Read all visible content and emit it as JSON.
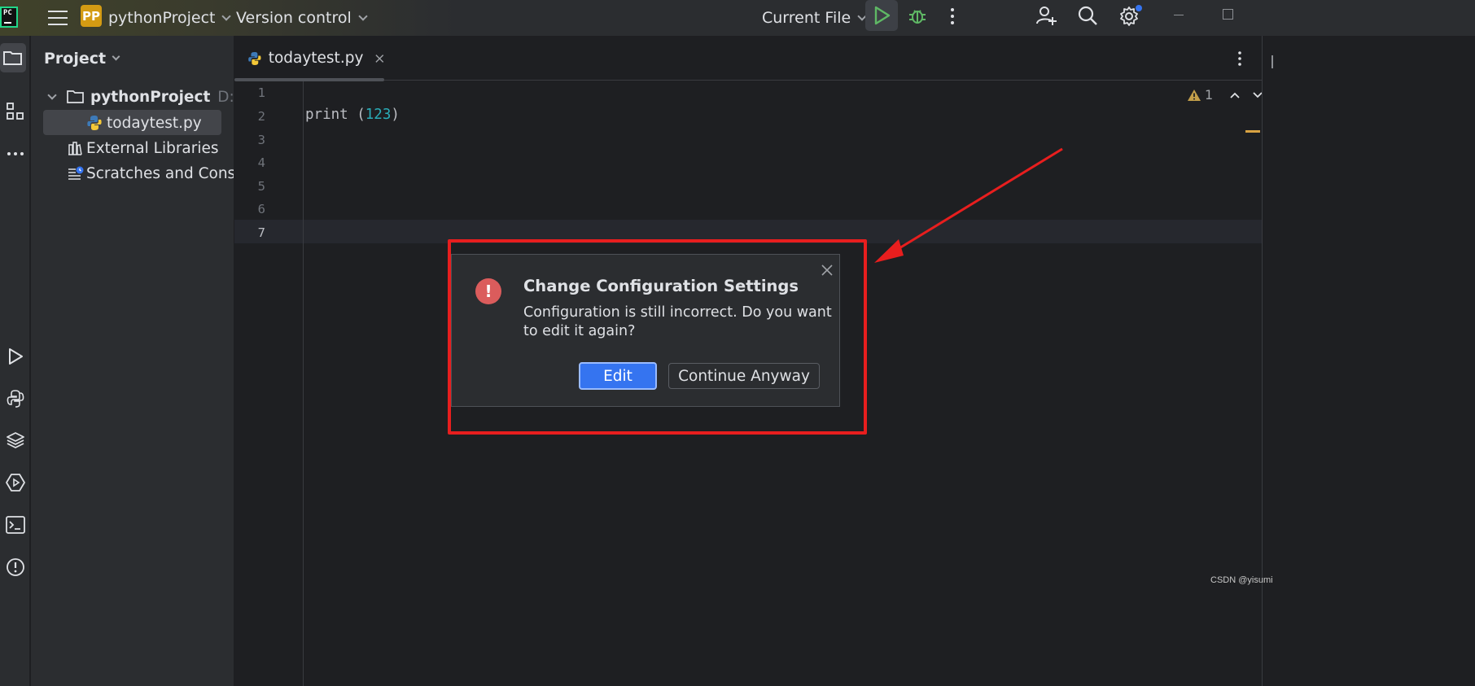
{
  "titlebar": {
    "logo_text": "PC",
    "project_badge": "PP",
    "project_name": "pythonProject",
    "vcs_label": "Version control",
    "run_config": "Current File"
  },
  "project_panel": {
    "title": "Project",
    "tree": [
      {
        "label": "pythonProject",
        "path": "D:\\Pyc"
      },
      {
        "label": "todaytest.py"
      },
      {
        "label": "External Libraries"
      },
      {
        "label": "Scratches and Consoles"
      }
    ]
  },
  "editor": {
    "tab_label": "todaytest.py",
    "line_numbers": [
      "1",
      "2",
      "3",
      "4",
      "5",
      "6",
      "7"
    ],
    "code_fn": "print (",
    "code_num": "123",
    "code_close": ")",
    "warning_count": "1"
  },
  "dialog": {
    "title": "Change Configuration Settings",
    "message": "Configuration is still incorrect. Do you want to edit it again?",
    "edit_label": "Edit",
    "continue_label": "Continue Anyway"
  },
  "watermark": "CSDN @yisumi",
  "colors": {
    "accent": "#3574f0",
    "error": "#db5c5c",
    "annotation": "#e81e1e",
    "run": "#5fb865",
    "project_badge": "#d49b13"
  }
}
